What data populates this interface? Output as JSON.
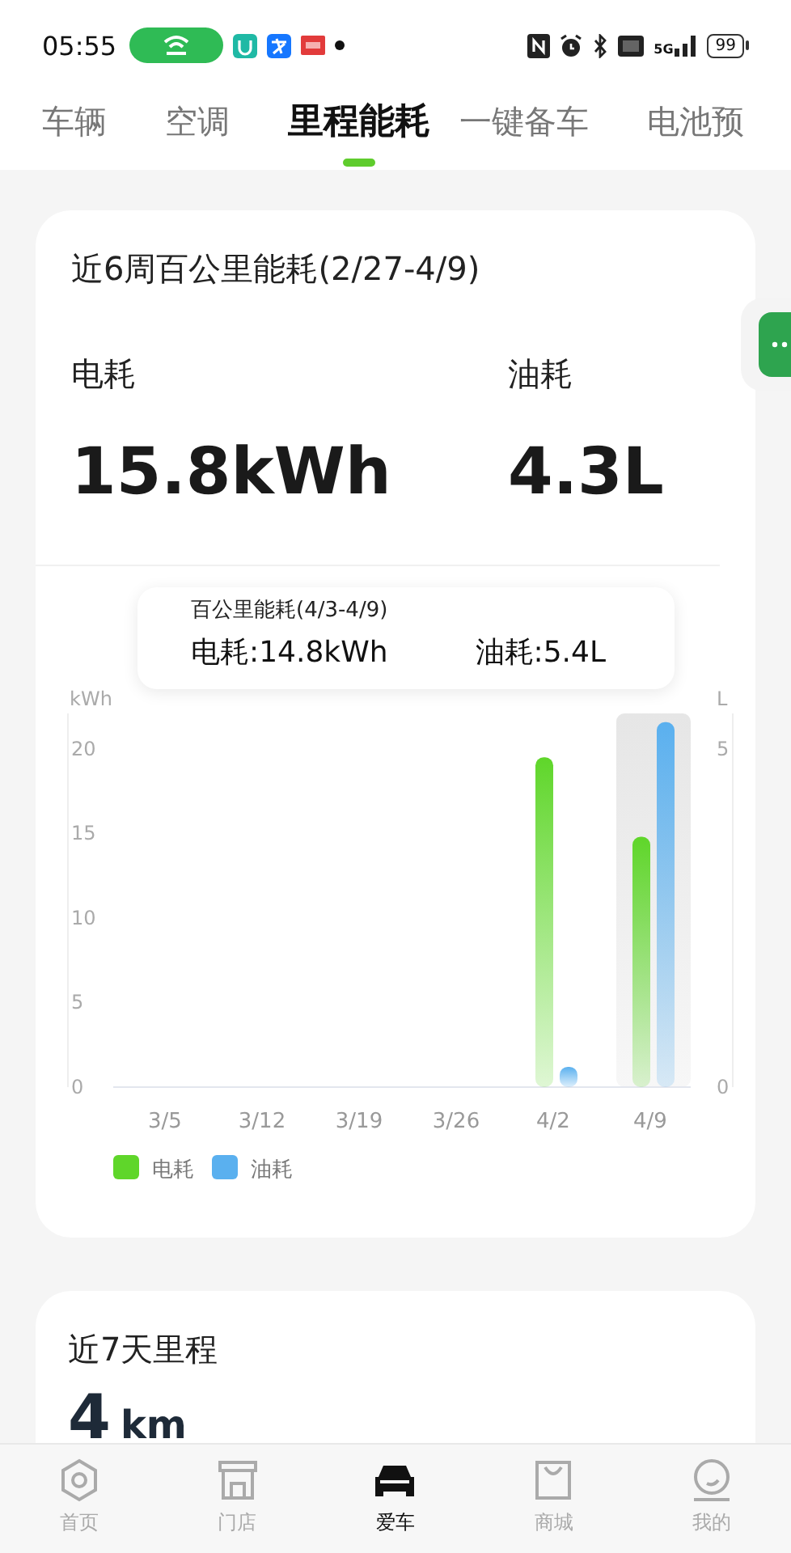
{
  "status_bar": {
    "time": "05:55",
    "network": "5G",
    "battery": "99"
  },
  "tabs": [
    {
      "label": "车辆",
      "selected": false
    },
    {
      "label": "空调",
      "selected": false
    },
    {
      "label": "里程能耗",
      "selected": true
    },
    {
      "label": "一键备车",
      "selected": false
    },
    {
      "label": "电池预",
      "selected": false
    }
  ],
  "energy_card": {
    "title": "近6周百公里能耗(2/27-4/9)",
    "metrics": [
      {
        "label": "电耗",
        "value": "15.8kWh"
      },
      {
        "label": "油耗",
        "value": "4.3L"
      }
    ],
    "tooltip": {
      "title": "百公里能耗(4/3-4/9)",
      "items": [
        "电耗:14.8kWh",
        "油耗:5.4L"
      ]
    },
    "chart_data": {
      "type": "bar",
      "categories": [
        "3/5",
        "3/12",
        "3/19",
        "3/26",
        "4/2",
        "4/9"
      ],
      "ylabel": "kWh",
      "y2label": "L",
      "ylim": [
        0,
        22.1
      ],
      "y2lim": [
        0,
        5.53
      ],
      "yticks": [
        0,
        5,
        10,
        15,
        20
      ],
      "y2ticks": [
        0,
        5
      ],
      "series": [
        {
          "name": "电耗",
          "color": "#5fd62a",
          "values": [
            0,
            0,
            0,
            0,
            19.5,
            14.8
          ]
        },
        {
          "name": "油耗",
          "color": "#5ab0ef",
          "axis": "y2",
          "values": [
            0,
            0,
            0,
            0,
            0.3,
            5.4
          ]
        }
      ],
      "bands": [
        {
          "axis": "x",
          "from": "4/9",
          "to": "4/9"
        }
      ],
      "legend": "bottom"
    }
  },
  "mileage_card": {
    "title": "近7天里程",
    "value": "4",
    "unit": "km"
  },
  "bottom_nav": [
    {
      "label": "首页",
      "selected": false
    },
    {
      "label": "门店",
      "selected": false
    },
    {
      "label": "爱车",
      "selected": true
    },
    {
      "label": "商城",
      "selected": false
    },
    {
      "label": "我的",
      "selected": false
    }
  ]
}
